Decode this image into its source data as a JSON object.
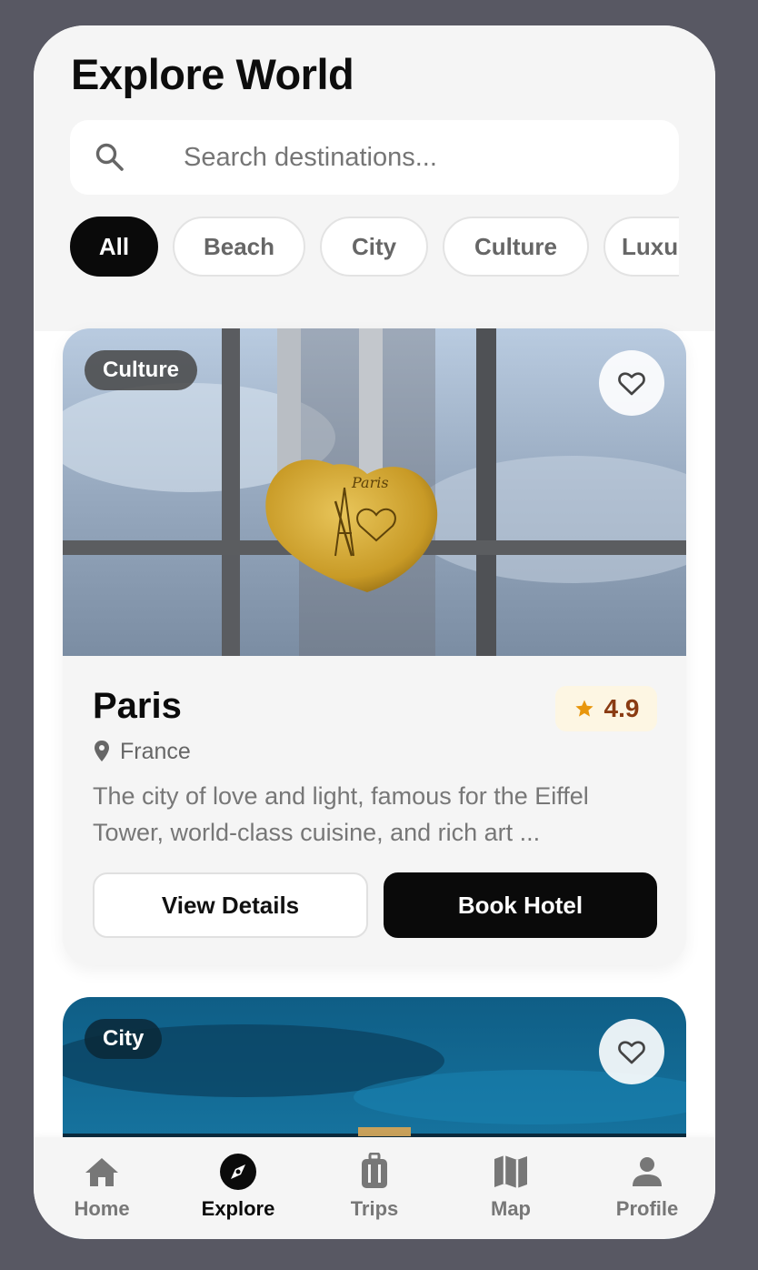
{
  "header": {
    "title": "Explore World"
  },
  "search": {
    "placeholder": "Search destinations...",
    "icon": "search-icon"
  },
  "categories": [
    "All",
    "Beach",
    "City",
    "Culture",
    "Luxury"
  ],
  "selected_category": "All",
  "destinations": [
    {
      "badge": "Culture",
      "name": "Paris",
      "rating": "4.9",
      "country": "France",
      "description": "The city of love and light, famous for the Eiffel Tower, world-class cuisine, and rich art ...",
      "view_label": "View Details",
      "book_label": "Book Hotel"
    },
    {
      "badge": "City"
    }
  ],
  "tabs": [
    {
      "label": "Home",
      "icon": "home-icon"
    },
    {
      "label": "Explore",
      "icon": "compass-icon",
      "active": true
    },
    {
      "label": "Trips",
      "icon": "suitcase-icon"
    },
    {
      "label": "Map",
      "icon": "map-icon"
    },
    {
      "label": "Profile",
      "icon": "person-icon"
    }
  ],
  "colors": {
    "accent": "#0a0a0a",
    "star": "#e8960c",
    "rating_bg": "#fdf6e3",
    "rating_text": "#8a3b12"
  }
}
